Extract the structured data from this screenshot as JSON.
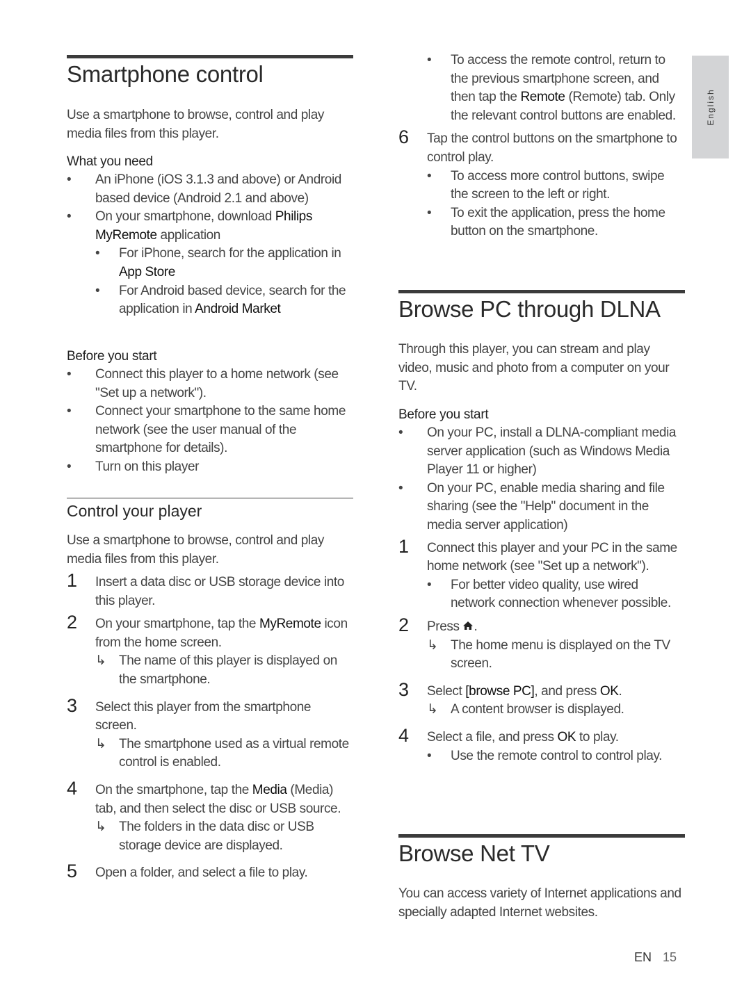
{
  "side_tab": {
    "label": "English"
  },
  "footer": {
    "lang": "EN",
    "page": "15"
  },
  "left": {
    "title": "Smartphone control",
    "intro": "Use a smartphone to browse, control and play media files from this player.",
    "need_heading": "What you need",
    "need": [
      {
        "pre": "An iPhone (iOS 3.1.3 and above) or Android based device (Android 2.1 and above)"
      },
      {
        "pre": "On your smartphone, download ",
        "bold": "Philips MyRemote",
        "post": " application"
      }
    ],
    "need_sub": [
      {
        "pre": "For iPhone, search for the application in ",
        "bold": "App Store"
      },
      {
        "pre": "For Android based device, search for the application in ",
        "bold": "Android Market"
      }
    ],
    "before_heading": "Before you start",
    "before": [
      "Connect this player to a home network (see \"Set up a network\").",
      "Connect your smartphone to the same home network (see the user manual of the smartphone for details).",
      "Turn on this player"
    ],
    "control_title": "Control your player",
    "control_intro": "Use a smartphone to browse, control and play media files from this player.",
    "steps": {
      "s1": {
        "n": "1",
        "text": "Insert a data disc or USB storage device into this player."
      },
      "s2": {
        "n": "2",
        "pre": "On your smartphone, tap the ",
        "bold": "MyRemote",
        "post": " icon from the home screen.",
        "result": "The name of this player is displayed on the smartphone."
      },
      "s3": {
        "n": "3",
        "text": "Select this player from the smartphone screen.",
        "result": "The smartphone used as a virtual remote control is enabled."
      },
      "s4": {
        "n": "4",
        "pre": "On the smartphone, tap the ",
        "bold": "Media",
        "post": " (Media) tab, and then select the disc or USB source.",
        "result": "The folders in the data disc or USB storage device are displayed."
      },
      "s5": {
        "n": "5",
        "text": "Open a folder, and select a file to play."
      }
    }
  },
  "right": {
    "cont_bullet": {
      "pre": "To access the remote control, return to the previous smartphone screen, and then tap the ",
      "bold": "Remote",
      "post": " (Remote) tab. Only the relevant control buttons are enabled."
    },
    "s6": {
      "n": "6",
      "text": "Tap the control buttons on the smartphone to control play."
    },
    "s6_bullets": [
      "To access more control buttons, swipe the screen to the left or right.",
      "To exit the application, press the home button on the smartphone."
    ],
    "dlna_title": "Browse PC through DLNA",
    "dlna_intro": "Through this player, you can stream and play video, music and photo from a computer on your TV.",
    "before_heading": "Before you start",
    "before": [
      "On your PC, install a DLNA-compliant media server application (such as Windows Media Player 11 or higher)",
      "On your PC, enable media sharing and file sharing (see the \"Help\" document in the media server application)"
    ],
    "d1": {
      "n": "1",
      "text": "Connect this player and your PC in the same home network (see \"Set up a network\").",
      "bullet": "For better video quality, use wired network connection whenever possible."
    },
    "d2": {
      "n": "2",
      "pre": "Press ",
      "post": ".",
      "icon": "home-icon",
      "result": "The home menu is displayed on the TV screen."
    },
    "d3": {
      "n": "3",
      "pre": "Select ",
      "bold1": "[browse PC]",
      "mid": ", and press ",
      "bold2": "OK",
      "post": ".",
      "result": "A content browser is displayed."
    },
    "d4": {
      "n": "4",
      "pre": "Select a file, and press ",
      "bold": "OK",
      "post": " to play.",
      "bullet": "Use the remote control to control play."
    },
    "nettv_title": "Browse Net TV",
    "nettv_intro": "You can access variety of Internet applications and specially adapted Internet websites."
  },
  "markers": {
    "bullet": "•",
    "arrow": "↳"
  }
}
